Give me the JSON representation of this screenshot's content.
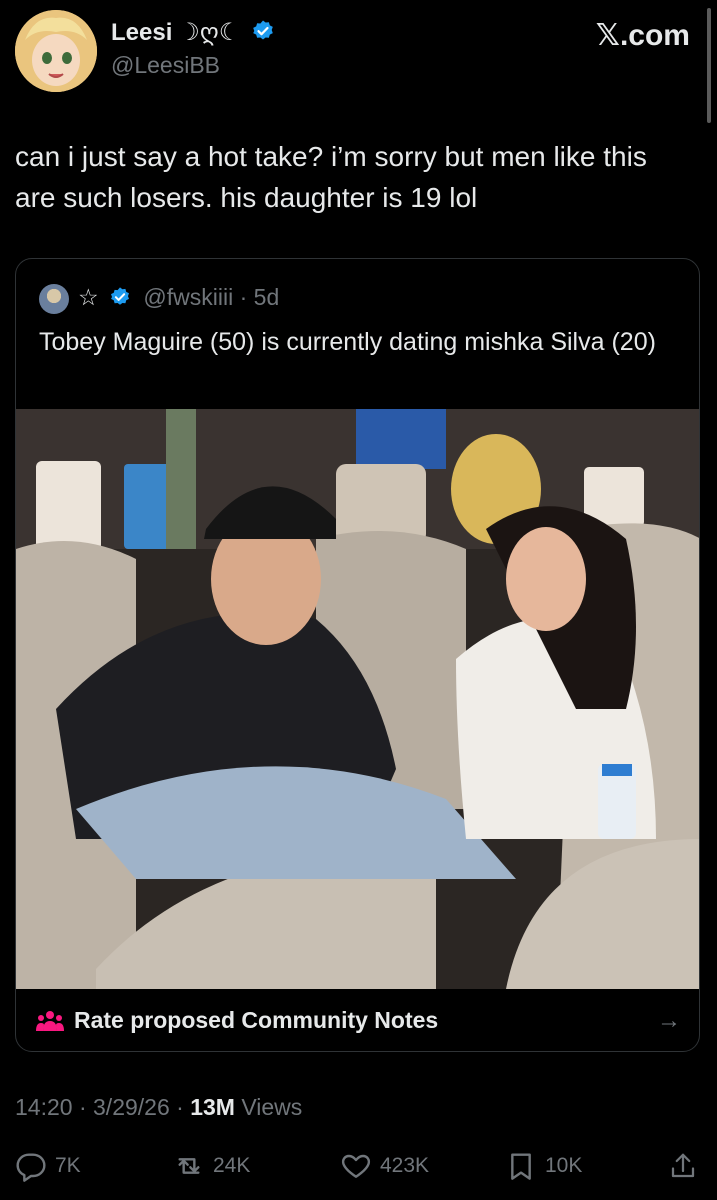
{
  "header": {
    "display_name": "Leesi",
    "name_symbols": "☽ღ☾",
    "handle": "@LeesiBB",
    "site": "𝕏.com"
  },
  "tweet": {
    "text": "can i just say a hot take? i’m sorry but men like this are such losers. his daughter is 19 lol"
  },
  "quote": {
    "star": "☆",
    "handle": "@fwskiiii",
    "separator": "·",
    "age": "5d",
    "text": "Tobey Maguire (50) is currently dating mishka Silva (20)",
    "community_notes_label": "Rate proposed Community Notes",
    "arrow": "→"
  },
  "meta": {
    "time": "14:20",
    "date": "3/29/26",
    "views_count": "13M",
    "views_label": "Views"
  },
  "actions": {
    "replies": "7K",
    "reposts": "24K",
    "likes": "423K",
    "bookmarks": "10K"
  },
  "colors": {
    "background": "#000000",
    "text": "#e7e9ea",
    "secondary": "#71767b",
    "verified": "#1d9bf0",
    "community_notes": "#f91880"
  }
}
